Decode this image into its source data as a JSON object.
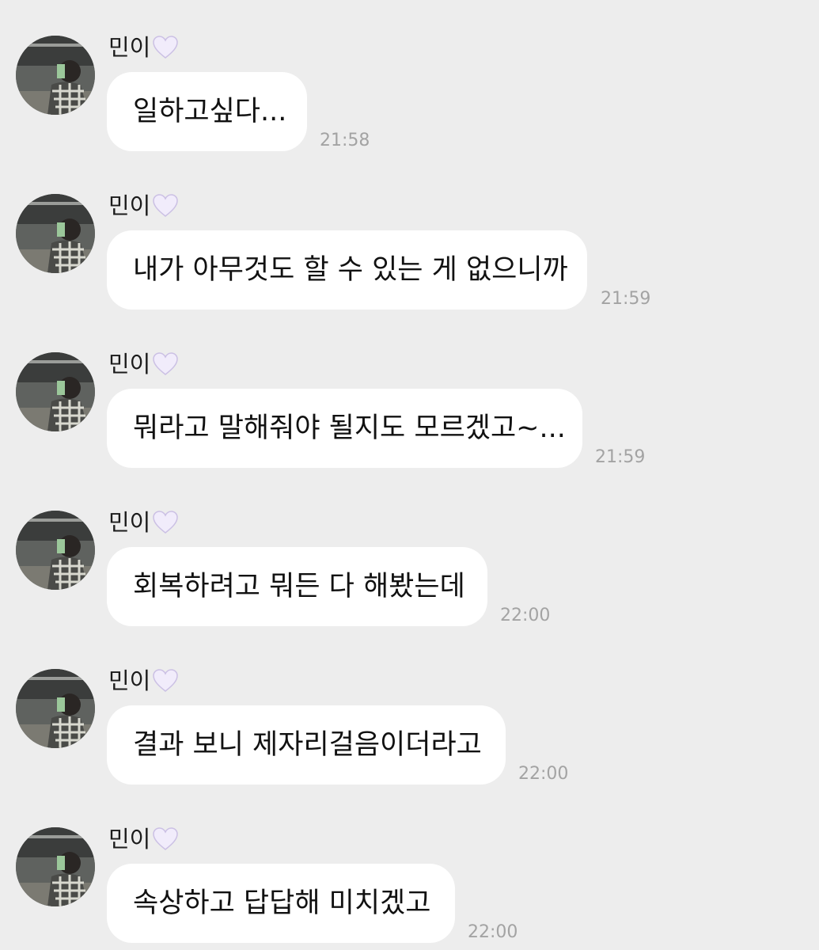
{
  "sender": {
    "name": "민이",
    "heart_icon": "white-heart-icon",
    "heart_color": "#f1ecfb"
  },
  "messages": [
    {
      "text": "일하고싶다...",
      "time": "21:58"
    },
    {
      "text": "내가 아무것도 할 수 있는 게 없으니까",
      "time": "21:59"
    },
    {
      "text": "뭐라고 말해줘야 될지도 모르겠고~...",
      "time": "21:59"
    },
    {
      "text": "회복하려고 뭐든 다 해봤는데",
      "time": "22:00"
    },
    {
      "text": "결과 보니 제자리걸음이더라고",
      "time": "22:00"
    },
    {
      "text": "속상하고 답답해 미치겠고",
      "time": "22:00"
    }
  ],
  "colors": {
    "background": "#ededed",
    "bubble": "#ffffff",
    "timestamp": "#a3a3a3"
  }
}
